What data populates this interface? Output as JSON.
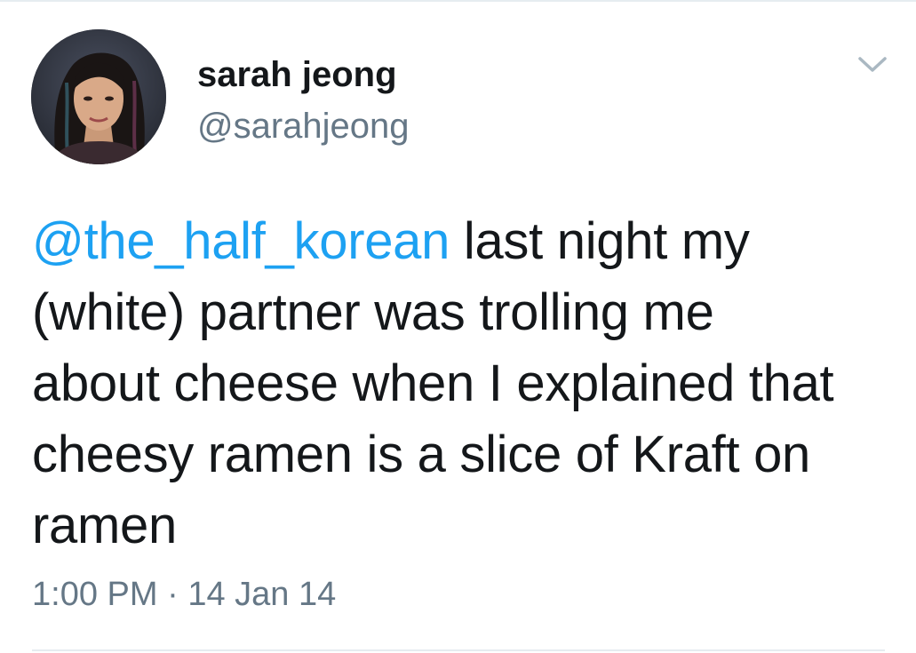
{
  "tweet": {
    "author": {
      "display_name": "sarah jeong",
      "handle": "@sarahjeong",
      "avatar_icon": "profile-photo"
    },
    "menu_icon": "chevron-down-icon",
    "mention": "@the_half_korean",
    "body": " last night my (white) partner was trolling me about cheese when I explained that cheesy ramen is a slice of Kraft on ramen",
    "time": "1:00 PM",
    "separator": "·",
    "date": "14 Jan 14"
  },
  "colors": {
    "link": "#1da1f2",
    "text": "#14171a",
    "secondary": "#657786",
    "divider": "#e6ecf0"
  }
}
